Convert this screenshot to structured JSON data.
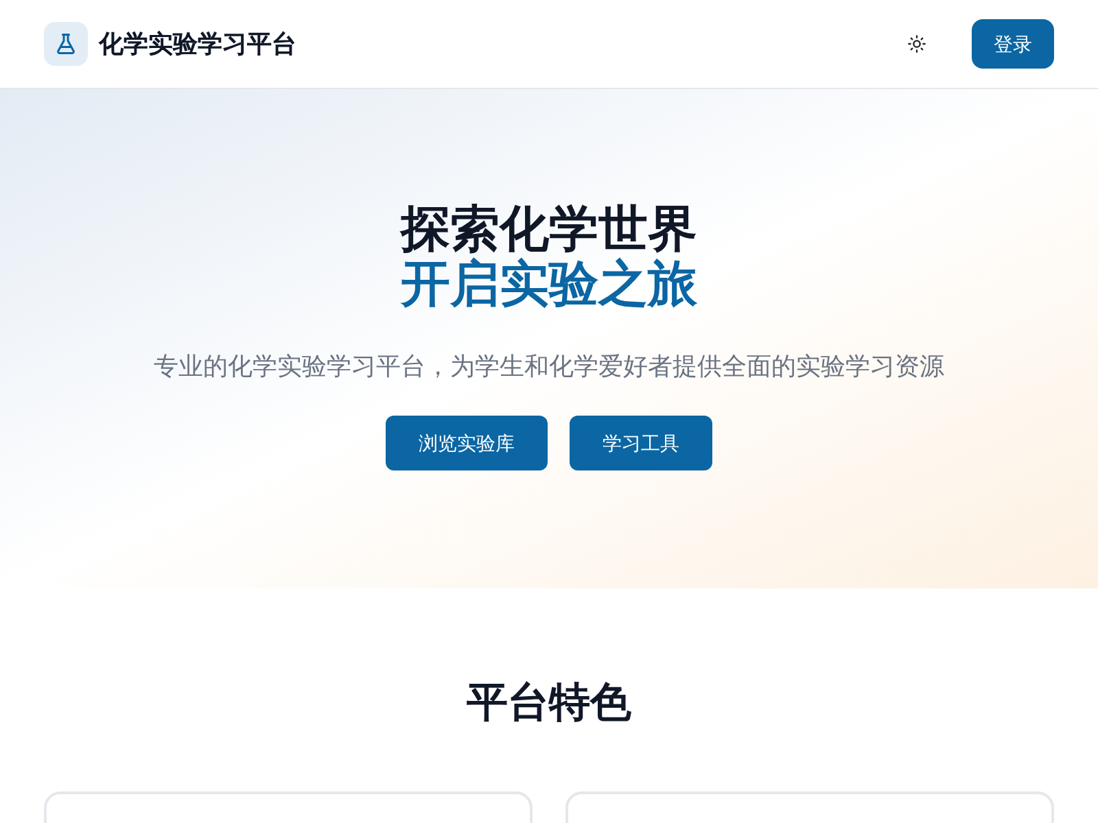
{
  "header": {
    "brand": "化学实验学习平台",
    "login_button": "登录"
  },
  "hero": {
    "title": "探索化学世界",
    "title_accent": "开启实验之旅",
    "subtitle": "专业的化学实验学习平台，为学生和化学爱好者提供全面的实验学习资源",
    "buttons": [
      "浏览实验库",
      "学习工具"
    ]
  },
  "features": {
    "title": "平台特色",
    "cards": [
      {
        "kind": "card"
      },
      {
        "kind": "card"
      }
    ]
  }
}
